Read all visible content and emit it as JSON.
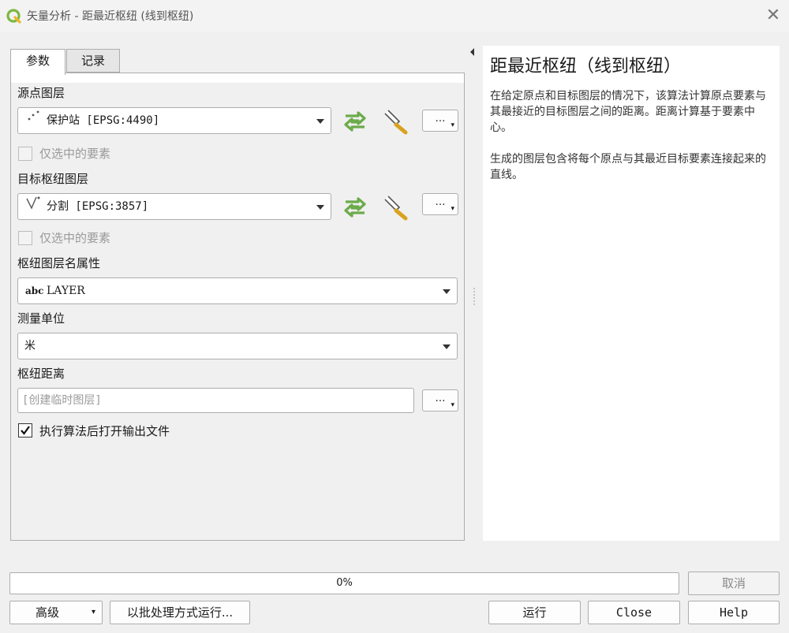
{
  "window": {
    "title": "矢量分析 - 距最近枢纽 (线到枢纽)",
    "icon": "qgis-logo-icon",
    "close_icon": "close-icon"
  },
  "tabs": [
    {
      "label": "参数",
      "active": true
    },
    {
      "label": "记录",
      "active": false
    }
  ],
  "params": {
    "source_label": "源点图层",
    "source_value": "保护站 [EPSG:4490]",
    "source_selected_only": "仅选中的要素",
    "target_label": "目标枢纽图层",
    "target_value": "分割 [EPSG:3857]",
    "target_selected_only": "仅选中的要素",
    "name_attr_label": "枢纽图层名属性",
    "name_attr_prefix": "abc",
    "name_attr_value": "LAYER",
    "unit_label": "测量单位",
    "unit_value": "米",
    "distance_label": "枢纽距离",
    "distance_placeholder": "[创建临时图层]",
    "open_output_label": "执行算法后打开输出文件",
    "open_output_checked": true,
    "ellipsis": "…"
  },
  "help": {
    "title": "距最近枢纽（线到枢纽）",
    "p1": "在给定原点和目标图层的情况下，该算法计算原点要素与其最接近的目标图层之间的距离。距离计算基于要素中心。",
    "p2": "生成的图层包含将每个原点与其最近目标要素连接起来的直线。"
  },
  "footer": {
    "progress": "0%",
    "progress_value": 0,
    "cancel": "取消",
    "advanced": "高级",
    "batch": "以批处理方式运行...",
    "run": "运行",
    "close": "Close",
    "help": "Help"
  },
  "colors": {
    "accent_green": "#6cab4b",
    "window_bg": "#f0f0f0",
    "border": "#adadad"
  }
}
